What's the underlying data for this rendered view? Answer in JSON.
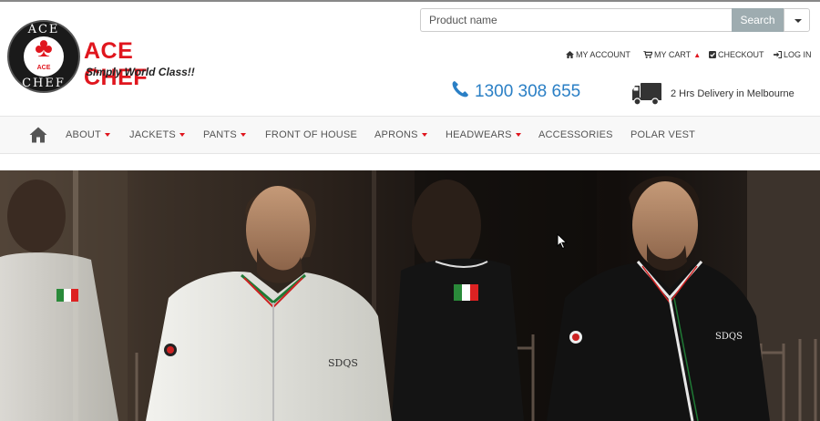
{
  "brand": {
    "logo_top": "ACE",
    "logo_bottom": "CHEF",
    "logo_mini": "ACE",
    "name": "ACE CHEF",
    "tagline": "Simply World Class!!"
  },
  "search": {
    "placeholder": "Product name",
    "button_label": "Search"
  },
  "account_links": [
    {
      "icon": "home-icon",
      "label": "MY ACCOUNT"
    },
    {
      "icon": "cart-icon",
      "label": "MY CART"
    },
    {
      "icon": "check-square-icon",
      "label": "CHECKOUT"
    },
    {
      "icon": "sign-in-icon",
      "label": "LOG IN"
    }
  ],
  "contact": {
    "phone": "1300 308 655",
    "delivery": "2 Hrs Delivery in Melbourne"
  },
  "nav": {
    "home_icon": "home-icon",
    "items": [
      {
        "label": "ABOUT",
        "has_dropdown": true
      },
      {
        "label": "JACKETS",
        "has_dropdown": true
      },
      {
        "label": "PANTS",
        "has_dropdown": true
      },
      {
        "label": "FRONT OF HOUSE",
        "has_dropdown": false
      },
      {
        "label": "APRONS",
        "has_dropdown": true
      },
      {
        "label": "HEADWEARS",
        "has_dropdown": true
      },
      {
        "label": "ACCESSORIES",
        "has_dropdown": false
      },
      {
        "label": "POLAR VEST",
        "has_dropdown": false
      }
    ]
  },
  "hero": {
    "jacket_text_left": "SDQS",
    "jacket_text_right": "SDQS"
  },
  "colors": {
    "brand_red": "#e0161e",
    "phone_blue": "#2a7fc5",
    "search_button": "#9eacb0"
  }
}
